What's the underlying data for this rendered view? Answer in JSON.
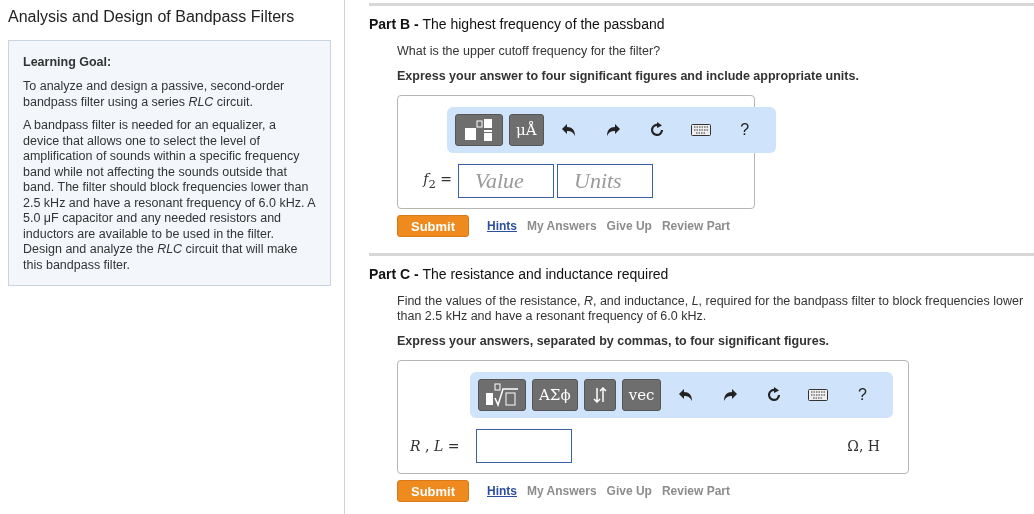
{
  "sidebar": {
    "title": "Analysis and Design of Bandpass Filters",
    "goal": {
      "heading": "Learning Goal:",
      "paragraphs": [
        "To analyze and design a passive, second-order bandpass filter using a series *RLC* circuit.",
        "A bandpass filter is needed for an equalizer, a device that allows one to select the level of amplification of sounds within a specific frequency band while not affecting the sounds outside that band. The filter should block frequencies lower than 2.5 kHz and have a resonant frequency of 6.0 kHz. A 5.0 μF capacitor and any needed resistors and inductors are available to be used in the filter. Design and analyze the *RLC* circuit that will make this bandpass filter."
      ]
    }
  },
  "parts": [
    {
      "label": "Part B -",
      "title": "The highest frequency of the passband",
      "question": "What is the upper cutoff frequency for the filter?",
      "instruction": "Express your answer to four significant figures and include appropriate units.",
      "toolbar": [
        {
          "kind": "template"
        },
        {
          "kind": "text",
          "label": "μÅ"
        },
        {
          "kind": "undo"
        },
        {
          "kind": "redo"
        },
        {
          "kind": "reset"
        },
        {
          "kind": "keyboard"
        },
        {
          "kind": "help",
          "label": "?"
        }
      ],
      "answer": {
        "kind": "value_units",
        "variable": "*f*$_{2}$ =",
        "placeholders": [
          "Value",
          "Units"
        ]
      },
      "actions": [
        {
          "label": "Submit",
          "kind": "submit"
        },
        {
          "label": "Hints",
          "kind": "link",
          "disabled": false
        },
        {
          "label": "My Answers",
          "kind": "link",
          "disabled": true
        },
        {
          "label": "Give Up",
          "kind": "link",
          "disabled": true
        },
        {
          "label": "Review Part",
          "kind": "link",
          "disabled": true
        }
      ]
    },
    {
      "label": "Part C -",
      "title": "The resistance and inductance required",
      "question": "Find the values of the resistance, *R*, and inductance, *L*, required for the bandpass filter to block frequencies lower than 2.5 kHz and have a resonant frequency of 6.0 kHz.",
      "instruction": "Express your answers, separated by commas, to four significant figures.",
      "toolbar": [
        {
          "kind": "root"
        },
        {
          "kind": "text",
          "label": "ΑΣϕ"
        },
        {
          "kind": "arrows"
        },
        {
          "kind": "text",
          "label": "vec"
        },
        {
          "kind": "undo"
        },
        {
          "kind": "redo"
        },
        {
          "kind": "reset"
        },
        {
          "kind": "keyboard"
        },
        {
          "kind": "help",
          "label": "?"
        }
      ],
      "answer": {
        "kind": "single",
        "variable": "*R* , *L* =",
        "units": "Ω, H"
      },
      "actions": [
        {
          "label": "Submit",
          "kind": "submit"
        },
        {
          "label": "Hints",
          "kind": "link",
          "disabled": false
        },
        {
          "label": "My Answers",
          "kind": "link",
          "disabled": true
        },
        {
          "label": "Give Up",
          "kind": "link",
          "disabled": true
        },
        {
          "label": "Review Part",
          "kind": "link",
          "disabled": true
        }
      ]
    }
  ]
}
